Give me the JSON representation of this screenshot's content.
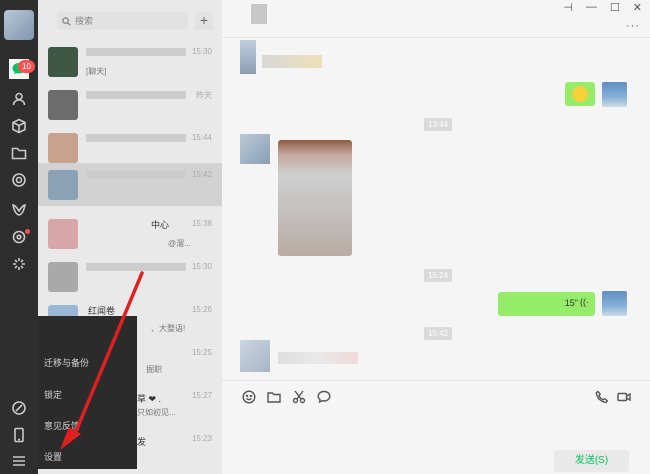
{
  "sidebar": {
    "unread_badge": "10"
  },
  "search": {
    "placeholder": "搜索",
    "add_label": "+"
  },
  "chat_list": [
    {
      "time": "15:30",
      "preview": "[聊天]"
    },
    {
      "time": "昨天",
      "preview": ""
    },
    {
      "time": "15:44",
      "preview": ""
    },
    {
      "time": "15:42",
      "preview": ""
    },
    {
      "time": "15:38",
      "preview": "中心",
      "preview2": "@溜..."
    },
    {
      "time": "15:30",
      "preview": ""
    },
    {
      "time": "15:26",
      "title": "红闻卷",
      "preview": "播工具",
      "preview2": "、大整语!"
    },
    {
      "time": "15:25",
      "preview": "掘职"
    },
    {
      "time": "15:27",
      "preview": "草 ❤ .",
      "preview2": "只如初见..."
    },
    {
      "time": "15:23",
      "preview": "发"
    }
  ],
  "menu": {
    "items": [
      "迁移与备份",
      "锁定",
      "意见反馈",
      "设置"
    ]
  },
  "chat": {
    "window_buttons": [
      "⊣",
      "—",
      "☐",
      "✕"
    ],
    "more_label": "···",
    "timestamps": [
      "13:44",
      "15:24",
      "15:42"
    ],
    "voice_duration": "15\"",
    "send_button": "发送(S)"
  },
  "colors": {
    "bubble_me": "#95ec69",
    "send_text": "#07c160",
    "badge": "#fa5151",
    "arrow": "#e02020"
  }
}
